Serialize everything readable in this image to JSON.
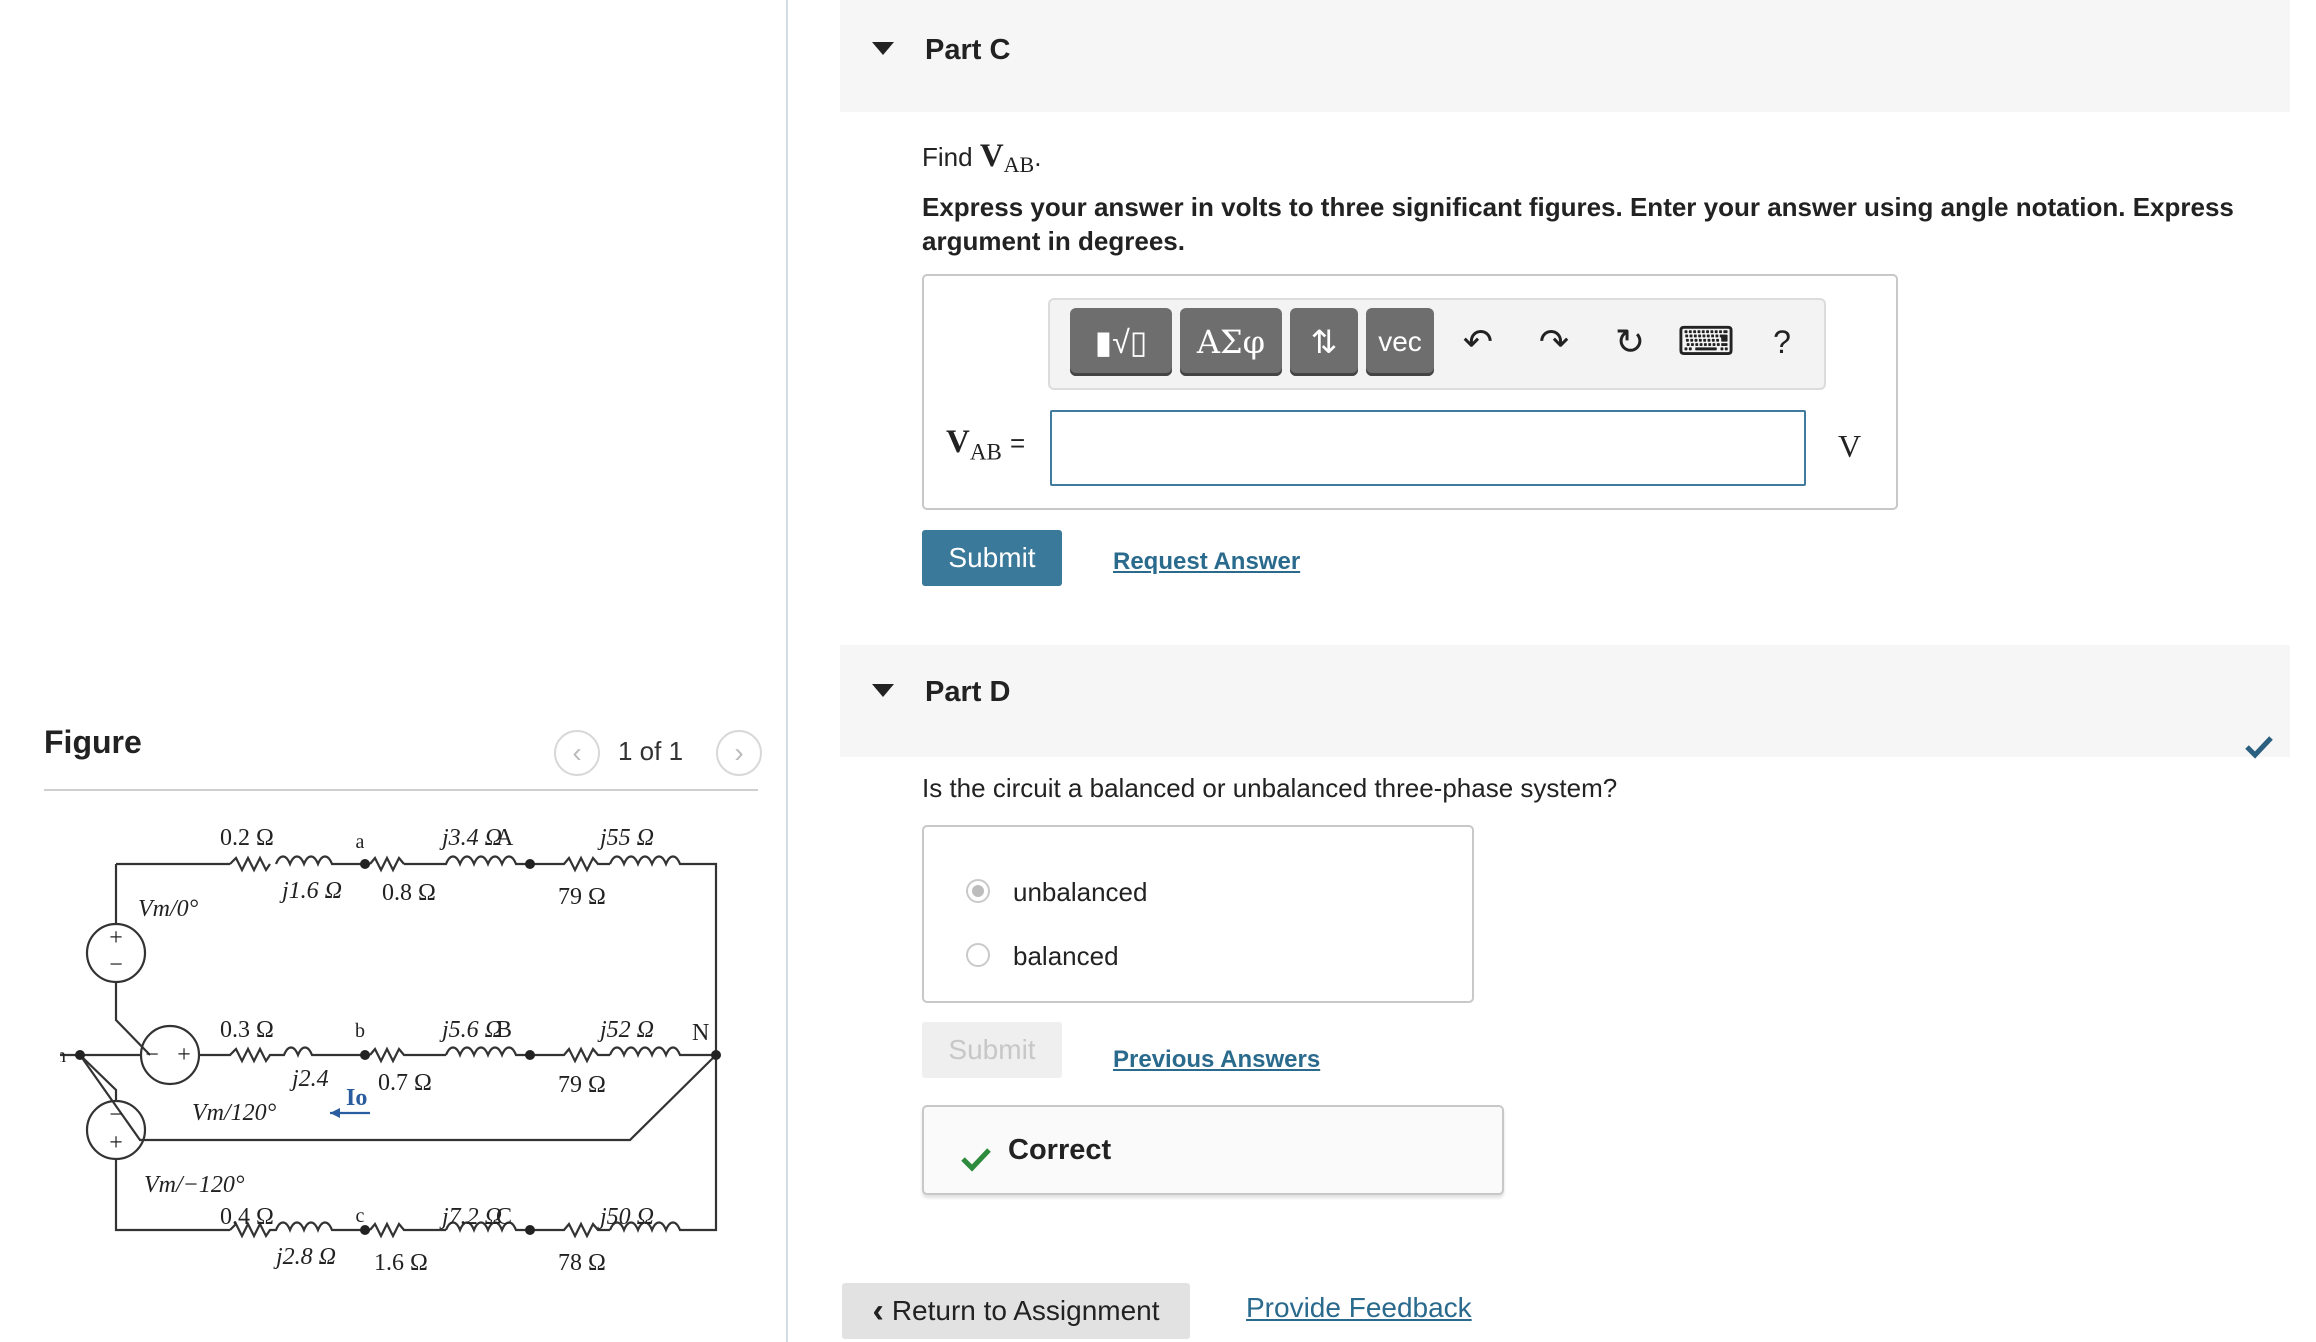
{
  "figure": {
    "title": "Figure",
    "pager": "1 of 1",
    "circuit_labels": {
      "r_a1": "0.2 Ω",
      "x_a1": "j1.6 Ω",
      "node_a": "a",
      "r_a2": "0.8 Ω",
      "x_a2": "j3.4 Ω",
      "node_A": "A",
      "x_a3": "j55 Ω",
      "r_a3": "79 Ω",
      "src_a": "Vm/0°",
      "r_b1": "0.3 Ω",
      "x_b1": "j2.4",
      "node_b": "b",
      "r_b2": "0.7 Ω",
      "x_b2": "j5.6 Ω",
      "node_B": "B",
      "x_b3": "j52 Ω",
      "node_N": "N",
      "r_b3": "79 Ω",
      "src_b": "Vm/120°",
      "current": "Io",
      "node_n": "n",
      "src_c": "Vm/−120°",
      "r_c1": "0.4 Ω",
      "x_c1": "j2.8 Ω",
      "node_c": "c",
      "r_c2": "1.6 Ω",
      "x_c2": "j7.2 Ω",
      "node_C": "C",
      "x_c3": "j50 Ω",
      "r_c3": "78 Ω"
    }
  },
  "partC": {
    "title": "Part C",
    "find_prefix": "Find",
    "find_var": "V",
    "find_sub": "AB",
    "instructions": "Express your answer in volts to three significant figures. Enter your answer using angle notation. Express argument in degrees.",
    "toolbar": {
      "templates": "▮√▯",
      "greek": "ΑΣφ",
      "arrows": "⇅",
      "vec": "vec",
      "undo": "↶",
      "redo": "↷",
      "reset": "↻",
      "keyboard": "⌨",
      "help": "?"
    },
    "var_label": "V",
    "var_sub": "AB",
    "equals": "=",
    "input_value": "",
    "unit": "V",
    "submit": "Submit",
    "request": "Request Answer"
  },
  "partD": {
    "title": "Part D",
    "question": "Is the circuit a balanced or unbalanced three-phase system?",
    "options": [
      {
        "label": "unbalanced",
        "selected": true
      },
      {
        "label": "balanced",
        "selected": false
      }
    ],
    "submit": "Submit",
    "previous": "Previous Answers",
    "feedback": "Correct"
  },
  "footer": {
    "return": "Return to Assignment",
    "feedback": "Provide Feedback"
  },
  "colors": {
    "accent": "#3a799a",
    "link": "#2a6a8d",
    "correct": "#2e8b3d"
  }
}
